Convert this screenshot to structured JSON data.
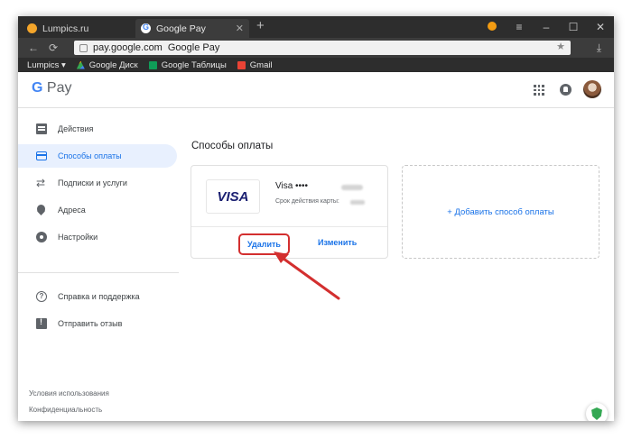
{
  "browser": {
    "tabs": [
      {
        "title": "Lumpics.ru",
        "active": false
      },
      {
        "title": "Google Pay",
        "active": true
      }
    ],
    "new_tab_label": "+",
    "url_host": "pay.google.com",
    "url_page_title": "Google Pay",
    "bookmarks": [
      {
        "label": "Lumpics ▾",
        "icon": "none"
      },
      {
        "label": "Google Диск",
        "icon": "drive-icon"
      },
      {
        "label": "Google Таблицы",
        "icon": "sheets-icon"
      },
      {
        "label": "Gmail",
        "icon": "gmail-icon"
      }
    ],
    "window_controls": [
      "≡",
      "–",
      "☐",
      "✕"
    ]
  },
  "header": {
    "logo_g": "G",
    "logo_text": " Pay"
  },
  "sidebar": {
    "items": [
      {
        "label": "Действия",
        "icon": "activity-icon",
        "active": false
      },
      {
        "label": "Способы оплаты",
        "icon": "card-icon",
        "active": true
      },
      {
        "label": "Подписки и услуги",
        "icon": "subscriptions-icon",
        "active": false
      },
      {
        "label": "Адреса",
        "icon": "location-icon",
        "active": false
      },
      {
        "label": "Настройки",
        "icon": "settings-icon",
        "active": false
      }
    ],
    "secondary": [
      {
        "label": "Справка и поддержка",
        "icon": "help-icon"
      },
      {
        "label": "Отправить отзыв",
        "icon": "feedback-icon"
      }
    ],
    "footer": {
      "terms": "Условия использования",
      "privacy": "Конфиденциальность"
    }
  },
  "main": {
    "title": "Способы оплаты",
    "card": {
      "brand_logo": "VISA",
      "name": "Visa ••••",
      "expiry_label": "Срок действия карты:",
      "delete_label": "Удалить",
      "edit_label": "Изменить"
    },
    "add_payment_label": "+ Добавить способ оплаты"
  },
  "colors": {
    "accent": "#1a73e8",
    "highlight_frame": "#d32f2f",
    "active_nav_bg": "#e8f0fe"
  }
}
